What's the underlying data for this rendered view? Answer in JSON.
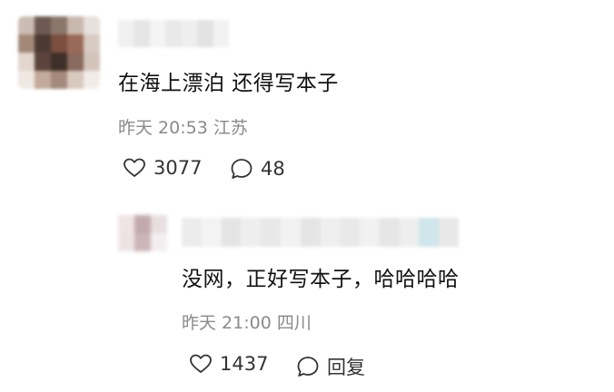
{
  "comment": {
    "text": "在海上漂泊 还得写本子",
    "meta": "昨天 20:53 江苏",
    "likes": "3077",
    "replies": "48"
  },
  "reply": {
    "text": "没网，正好写本子，哈哈哈哈",
    "meta": "昨天 21:00 四川",
    "likes": "1437",
    "reply_label": "回复"
  },
  "icons": {
    "like": "heart-outline-icon",
    "comment": "speech-bubble-icon"
  },
  "colors": {
    "text": "#111111",
    "meta": "#8a8a8a",
    "action": "#333333"
  }
}
